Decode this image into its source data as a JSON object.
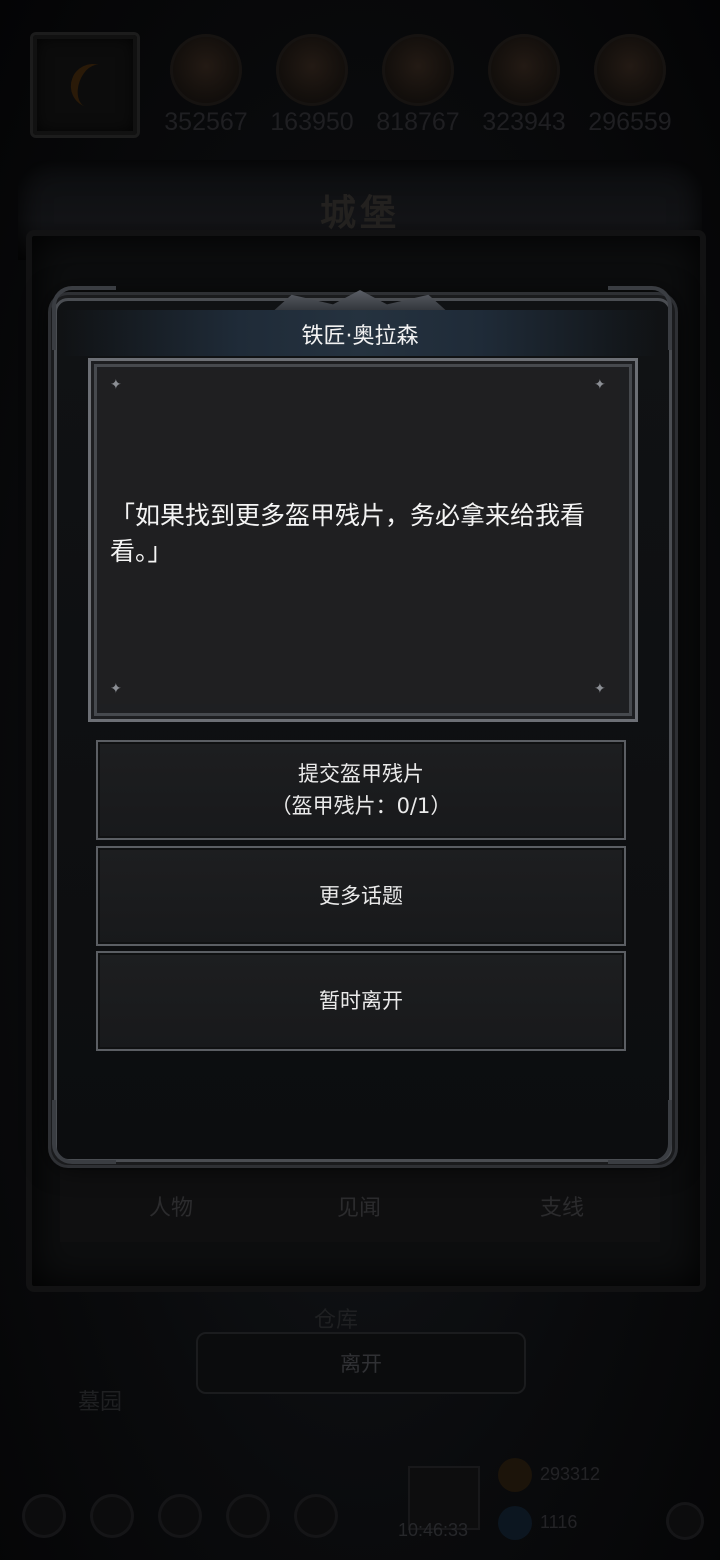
{
  "resources": {
    "values": [
      "352567",
      "163950",
      "818767",
      "323943",
      "296559"
    ],
    "icons": [
      "grain-icon",
      "wood-icon",
      "iron-icon",
      "crystal-icon",
      "stone-icon"
    ]
  },
  "castle": {
    "title": "城堡",
    "tabs": [
      "人物",
      "见闻",
      "支线"
    ],
    "labels": {
      "warehouse": "仓库",
      "cemetery": "墓园"
    },
    "leave_button": "离开"
  },
  "dialog": {
    "npc_name": "铁匠·奥拉森",
    "speech": "「如果找到更多盔甲残片，务必拿来给我看看。」",
    "options": [
      {
        "label": "提交盔甲残片",
        "sub": "（盔甲残片：0/1）"
      },
      {
        "label": "更多话题",
        "sub": ""
      },
      {
        "label": "暂时离开",
        "sub": ""
      }
    ]
  },
  "footer": {
    "clock": "10:46:33",
    "gold": "293312",
    "gems": "1116"
  },
  "colors": {
    "text_primary": "#f2f2f2",
    "option_border": "#5b5e63",
    "dim_text": "#2b2b2d"
  }
}
